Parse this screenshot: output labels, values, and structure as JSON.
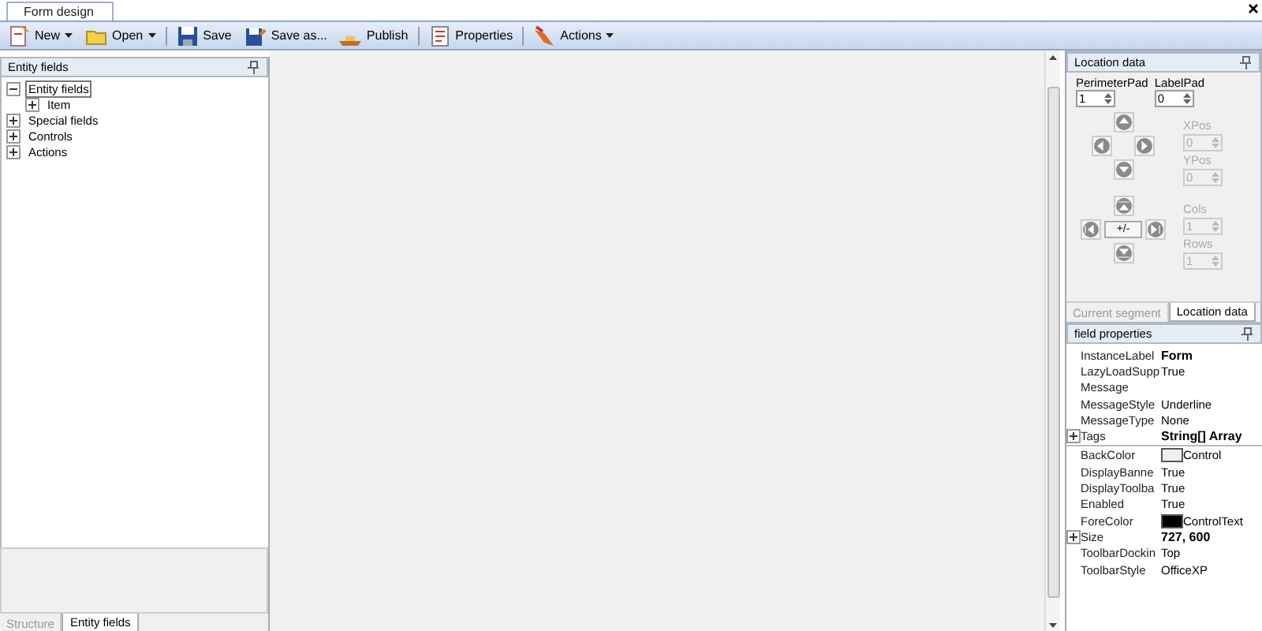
{
  "document_tab": {
    "label": "Form design",
    "selected": true
  },
  "toolbar": [
    {
      "label": "New",
      "kind": "new",
      "dropdown": true
    },
    {
      "label": "Open",
      "kind": "open",
      "dropdown": true
    },
    {
      "label": "Save",
      "kind": "save"
    },
    {
      "label": "Save as...",
      "kind": "saveas"
    },
    {
      "label": "Publish",
      "kind": "publish"
    },
    {
      "label": "Properties",
      "kind": "properties"
    },
    {
      "label": "Actions",
      "kind": "actions",
      "dropdown": true
    }
  ],
  "left_panel": {
    "title": "Entity fields",
    "tree": [
      {
        "label": "Entity fields",
        "expanded": true,
        "selected": true,
        "children": [
          {
            "label": "Item",
            "expanded": false,
            "selected": false
          }
        ]
      },
      {
        "label": "Special fields",
        "expanded": false,
        "selected": false
      },
      {
        "label": "Controls",
        "expanded": false,
        "selected": false
      },
      {
        "label": "Actions",
        "expanded": false,
        "selected": false
      }
    ],
    "tabs": [
      {
        "label": "Structure",
        "selected": false
      },
      {
        "label": "Entity fields",
        "selected": true
      }
    ]
  },
  "location_panel": {
    "title": "Location data",
    "pads": [
      {
        "label": "PerimeterPad",
        "value": "1",
        "disabled": false
      },
      {
        "label": "LabelPad",
        "value": "0",
        "disabled": false
      }
    ],
    "fields": [
      {
        "label": "XPos",
        "value": "0",
        "disabled": true
      },
      {
        "label": "YPos",
        "value": "0",
        "disabled": true
      },
      {
        "label": "Cols",
        "value": "1",
        "disabled": true
      },
      {
        "label": "Rows",
        "value": "1",
        "disabled": true
      }
    ],
    "center_button": "+/-",
    "tabs": [
      {
        "label": "Current segment",
        "selected": false
      },
      {
        "label": "Location data",
        "selected": true
      }
    ]
  },
  "properties_panel": {
    "title": "field properties",
    "groups": [
      {
        "rows": [
          {
            "name": "InstanceLabel",
            "value": "Form",
            "bold": true
          },
          {
            "name": "LazyLoadSupp",
            "value": "True"
          },
          {
            "name": "Message"
          },
          {
            "name": "MessageStyle",
            "value": "Underline"
          },
          {
            "name": "MessageType",
            "value": "None"
          },
          {
            "name": "Tags",
            "value": "String[] Array",
            "bold": true,
            "expandable": true
          }
        ]
      },
      {
        "rows": [
          {
            "name": "BackColor",
            "value": "Control",
            "color": "#f0f0f0"
          },
          {
            "name": "DisplayBanne",
            "value": "True"
          },
          {
            "name": "DisplayToolba",
            "value": "True"
          },
          {
            "name": "Enabled",
            "value": "True"
          },
          {
            "name": "ForeColor",
            "value": "ControlText",
            "color": "#000000"
          },
          {
            "name": "Size",
            "value": "727, 600",
            "bold": true,
            "expandable": true
          },
          {
            "name": "ToolbarDockin",
            "value": "Top"
          },
          {
            "name": "ToolbarStyle",
            "value": "OfficeXP"
          }
        ]
      }
    ]
  }
}
